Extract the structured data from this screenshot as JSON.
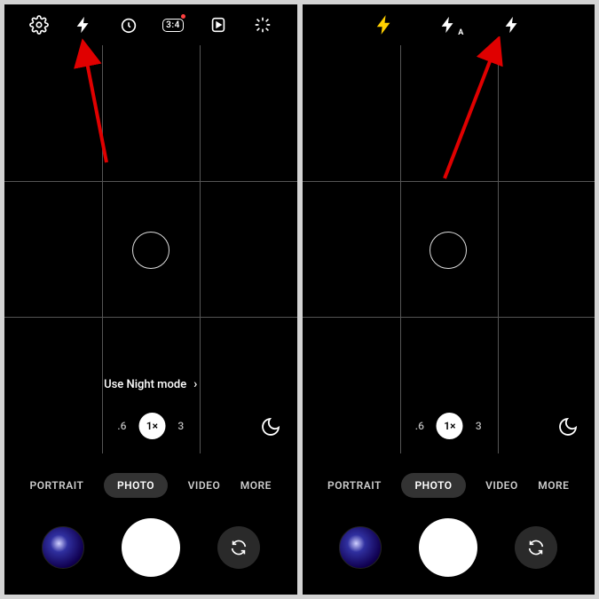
{
  "left": {
    "topbar": {
      "settings": "settings",
      "flash": "flash",
      "timer": "timer",
      "ratio": "3:4",
      "motion": "motion-photo",
      "filters": "filters"
    },
    "night_hint": "Use Night mode",
    "zoom": {
      "low": ".6",
      "active": "1×",
      "high": "3"
    },
    "modes": {
      "portrait": "PORTRAIT",
      "photo": "PHOTO",
      "video": "VIDEO",
      "more": "MORE"
    }
  },
  "right": {
    "topbar": {
      "flash_always": "flash-always-on",
      "flash_auto": "flash-auto",
      "flash_on": "flash-on"
    },
    "zoom": {
      "low": ".6",
      "active": "1×",
      "high": "3"
    },
    "modes": {
      "portrait": "PORTRAIT",
      "photo": "PHOTO",
      "video": "VIDEO",
      "more": "MORE"
    }
  }
}
